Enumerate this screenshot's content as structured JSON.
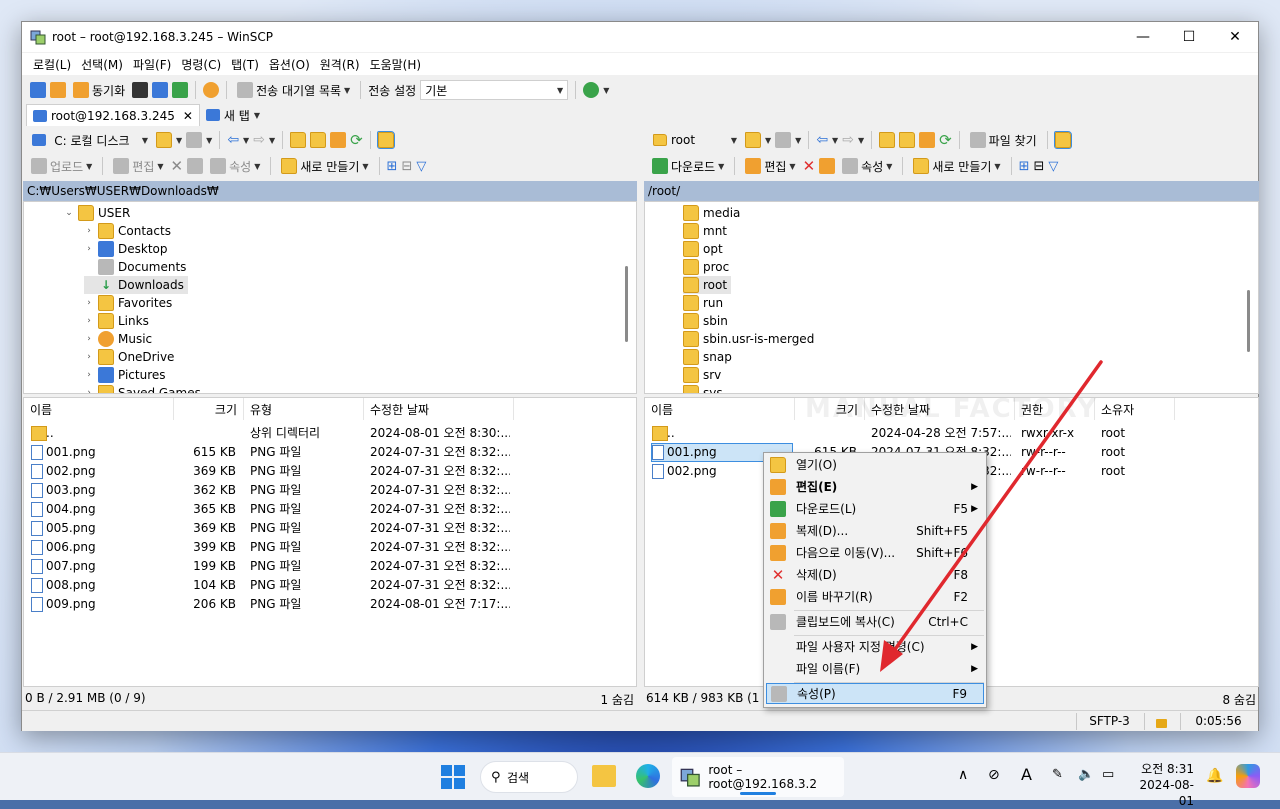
{
  "window": {
    "title": "root – root@192.168.3.245 – WinSCP"
  },
  "menu": [
    "로컬(L)",
    "선택(M)",
    "파일(F)",
    "명령(C)",
    "탭(T)",
    "옵션(O)",
    "원격(R)",
    "도움말(H)"
  ],
  "toolbar": {
    "sync_label": "동기화",
    "queue_label": "전송 대기열 목록",
    "transfer_settings_label": "전송 설정",
    "transfer_preset": "기본"
  },
  "tabs": {
    "session": "root@192.168.3.245",
    "new_tab": "새 탭"
  },
  "left": {
    "drive": "C: 로컬 디스크",
    "upload": "업로드",
    "edit": "편집",
    "props": "속성",
    "new": "새로 만들기",
    "path": "C:₩Users₩USER₩Downloads₩",
    "tree": [
      {
        "label": "USER",
        "chev": "⌄"
      },
      {
        "label": "Contacts",
        "chev": "›"
      },
      {
        "label": "Desktop",
        "chev": "›"
      },
      {
        "label": "Documents",
        "chev": ""
      },
      {
        "label": "Downloads",
        "chev": ""
      },
      {
        "label": "Favorites",
        "chev": "›"
      },
      {
        "label": "Links",
        "chev": "›"
      },
      {
        "label": "Music",
        "chev": "›"
      },
      {
        "label": "OneDrive",
        "chev": "›"
      },
      {
        "label": "Pictures",
        "chev": "›"
      },
      {
        "label": "Saved Games",
        "chev": "›"
      }
    ],
    "columns": [
      "이름",
      "크기",
      "유형",
      "수정한 날짜"
    ],
    "rows": [
      {
        "name": "..",
        "size": "",
        "type": "상위 디렉터리",
        "date": "2024-08-01 오전 8:30:..."
      },
      {
        "name": "001.png",
        "size": "615 KB",
        "type": "PNG 파일",
        "date": "2024-07-31 오전 8:32:..."
      },
      {
        "name": "002.png",
        "size": "369 KB",
        "type": "PNG 파일",
        "date": "2024-07-31 오전 8:32:..."
      },
      {
        "name": "003.png",
        "size": "362 KB",
        "type": "PNG 파일",
        "date": "2024-07-31 오전 8:32:..."
      },
      {
        "name": "004.png",
        "size": "365 KB",
        "type": "PNG 파일",
        "date": "2024-07-31 오전 8:32:..."
      },
      {
        "name": "005.png",
        "size": "369 KB",
        "type": "PNG 파일",
        "date": "2024-07-31 오전 8:32:..."
      },
      {
        "name": "006.png",
        "size": "399 KB",
        "type": "PNG 파일",
        "date": "2024-07-31 오전 8:32:..."
      },
      {
        "name": "007.png",
        "size": "199 KB",
        "type": "PNG 파일",
        "date": "2024-07-31 오전 8:32:..."
      },
      {
        "name": "008.png",
        "size": "104 KB",
        "type": "PNG 파일",
        "date": "2024-07-31 오전 8:32:..."
      },
      {
        "name": "009.png",
        "size": "206 KB",
        "type": "PNG 파일",
        "date": "2024-08-01 오전 7:17:..."
      }
    ],
    "status_left": "0 B / 2.91 MB (0 / 9)",
    "status_right": "1 숨김"
  },
  "right": {
    "dir": "root",
    "find_files": "파일 찾기",
    "download": "다운로드",
    "edit": "편집",
    "props": "속성",
    "new": "새로 만들기",
    "path": "/root/",
    "tree": [
      "media",
      "mnt",
      "opt",
      "proc",
      "root",
      "run",
      "sbin",
      "sbin.usr-is-merged",
      "snap",
      "srv",
      "sys"
    ],
    "columns": [
      "이름",
      "크기",
      "수정한 날짜",
      "권한",
      "소유자"
    ],
    "rows": [
      {
        "name": "..",
        "size": "",
        "date": "2024-04-28 오전 7:57:...",
        "perm": "rwxr-xr-x",
        "owner": "root"
      },
      {
        "name": "001.png",
        "size": "615 KB",
        "date": "2024-07-31 오전 8:32:...",
        "perm": "rw-r--r--",
        "owner": "root"
      },
      {
        "name": "002.png",
        "size": "",
        "date": "2024-07-31 오전 8:32:...",
        "perm": "rw-r--r--",
        "owner": "root"
      }
    ],
    "status_left": "614 KB / 983 KB (1 / 2)",
    "status_right": "8 숨김"
  },
  "context_menu": [
    {
      "label": "열기(O)",
      "shortcut": "",
      "arrow": false
    },
    {
      "label": "편집(E)",
      "shortcut": "",
      "arrow": true
    },
    {
      "label": "다운로드(L)",
      "shortcut": "F5",
      "arrow": true
    },
    {
      "label": "복제(D)...",
      "shortcut": "Shift+F5",
      "arrow": false
    },
    {
      "label": "다음으로 이동(V)...",
      "shortcut": "Shift+F6",
      "arrow": false
    },
    {
      "label": "삭제(D)",
      "shortcut": "F8",
      "arrow": false
    },
    {
      "label": "이름 바꾸기(R)",
      "shortcut": "F2",
      "arrow": false
    },
    {
      "label": "클립보드에 복사(C)",
      "shortcut": "Ctrl+C",
      "arrow": false
    },
    {
      "label": "파일 사용자 지정 명령(C)",
      "shortcut": "",
      "arrow": true
    },
    {
      "label": "파일 이름(F)",
      "shortcut": "",
      "arrow": true
    },
    {
      "label": "속성(P)",
      "shortcut": "F9",
      "arrow": false
    }
  ],
  "statusbar": {
    "protocol": "SFTP-3",
    "elapsed": "0:05:56"
  },
  "watermark": "MANUAL FACTORY",
  "taskbar": {
    "search": "검색",
    "app": "root – root@192.168.3.2",
    "time": "오전 8:31",
    "date": "2024-08-01"
  },
  "colors": {
    "path_bar": "#a9bcd6",
    "highlight": "#cce4f7",
    "arrow": "#e0282e"
  }
}
